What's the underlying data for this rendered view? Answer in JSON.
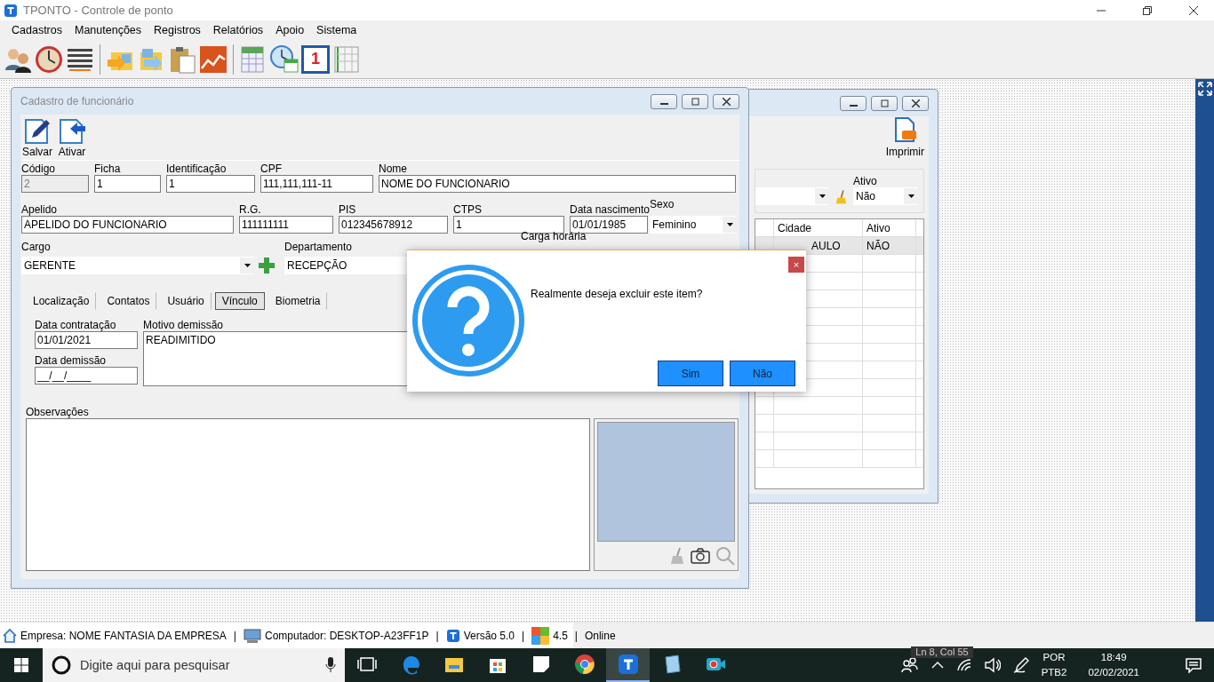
{
  "window": {
    "title": "TPONTO - Controle de ponto"
  },
  "menu": [
    "Cadastros",
    "Manutenções",
    "Registros",
    "Relatórios",
    "Apoio",
    "Sistema"
  ],
  "toolbar": {
    "calendar_day": "1"
  },
  "back_window": {
    "print_button": "Imprimir",
    "ativo_label": "Ativo",
    "ativo_value": "Não",
    "columns": [
      "Cidade",
      "Ativo"
    ],
    "rows": [
      {
        "cells": [
          "AULO",
          "NÃO"
        ],
        "selected": true
      }
    ]
  },
  "form": {
    "title": "Cadastro de funcionário",
    "actions": [
      "Salvar",
      "Ativar"
    ],
    "row1": [
      {
        "label": "Código",
        "value": "2",
        "disabled": true
      },
      {
        "label": "Ficha",
        "value": "1",
        "disabled": false
      },
      {
        "label": "Identificação",
        "value": "1",
        "disabled": false
      },
      {
        "label": "CPF",
        "value": "111,111,111-11",
        "disabled": false
      },
      {
        "label": "Nome",
        "value": "NOME DO FUNCIONARIO",
        "disabled": false
      }
    ],
    "row2": [
      {
        "label": "Apelido",
        "value": "APELIDO DO FUNCIONARIO"
      },
      {
        "label": "R.G.",
        "value": "111111111"
      },
      {
        "label": "PIS",
        "value": "012345678912"
      },
      {
        "label": "CTPS",
        "value": "1"
      },
      {
        "label": "Data nascimento",
        "value": "01/01/1985"
      }
    ],
    "sexo": {
      "label": "Sexo",
      "value": "Feminino"
    },
    "cargo": {
      "label": "Cargo",
      "value": "GERENTE"
    },
    "departamento": {
      "label": "Departamento",
      "value": "RECEPÇÃO"
    },
    "carga_label": "Carga horária",
    "tabs": [
      {
        "label": "Localização",
        "selected": false
      },
      {
        "label": "Contatos",
        "selected": false
      },
      {
        "label": "Usuário",
        "selected": false
      },
      {
        "label": "Vínculo",
        "selected": true
      },
      {
        "label": "Biometria",
        "selected": false
      }
    ],
    "data_contratacao": {
      "label": "Data contratação",
      "value": "01/01/2021"
    },
    "data_demissao": {
      "label": "Data demissão",
      "value": "__/__/____"
    },
    "motivo": {
      "label": "Motivo demissão",
      "value": "READIMITIDO"
    },
    "observacoes": {
      "label": "Observações"
    }
  },
  "dialog": {
    "message": "Realmente deseja excluir este item?",
    "buttons": [
      "Sim",
      "Não"
    ],
    "close": "×"
  },
  "status_bar": [
    {
      "kind": "home",
      "text": "Empresa: NOME FANTASIA DA EMPRESA"
    },
    {
      "kind": "computer",
      "text": "Computador: DESKTOP-A23FF1P"
    },
    {
      "kind": "app",
      "text": "Versão 5.0"
    },
    {
      "kind": "tiles",
      "text": "4.5"
    },
    {
      "kind": "none",
      "text": "Online"
    }
  ],
  "status_separator": "|",
  "editor_hint": "Ln 8, Col 55",
  "taskbar": {
    "search_placeholder": "Digite aqui para pesquisar",
    "apps": [
      {
        "kind": "taskview",
        "selected": false
      },
      {
        "kind": "edge",
        "selected": false
      },
      {
        "kind": "folder",
        "selected": false
      },
      {
        "kind": "store",
        "selected": false
      },
      {
        "kind": "note",
        "selected": false
      },
      {
        "kind": "chrome",
        "selected": false
      },
      {
        "kind": "tponto",
        "selected": true
      },
      {
        "kind": "notepad",
        "selected": false
      },
      {
        "kind": "camera",
        "selected": false
      }
    ],
    "language": [
      "POR",
      "PTB2"
    ],
    "time": "18:49",
    "date": "02/02/2021"
  }
}
